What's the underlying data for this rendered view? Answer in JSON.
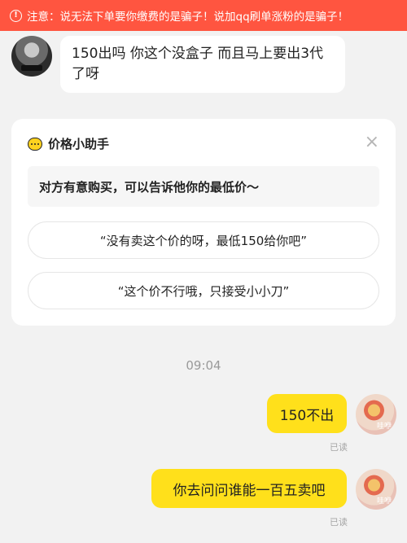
{
  "warning": {
    "icon": "exclamation-circle-icon",
    "text": "注意：说无法下单要你缴费的是骗子！说加qq刷单涨粉的是骗子！"
  },
  "messages_in": [
    {
      "text": "150出吗 你这个没盒子 而且马上要出3代了呀"
    }
  ],
  "price_helper": {
    "icon": "chat-bubble-icon",
    "title": "价格小助手",
    "close_icon": "close-icon",
    "tip": "对方有意购买，可以告诉他你的最低价～",
    "suggestions": [
      "“没有卖这个价的呀，最低150给你吧”",
      "“这个价不行哦，只接受小小刀”"
    ]
  },
  "timestamp": "09:04",
  "messages_out": [
    {
      "text": "150不出",
      "status": "已读"
    },
    {
      "text": "你去问问谁能一百五卖吧",
      "status": "已读"
    }
  ],
  "colors": {
    "warning_bg": "#ff5540",
    "outgoing_bubble": "#ffe01b",
    "page_bg": "#f2f2f2"
  }
}
